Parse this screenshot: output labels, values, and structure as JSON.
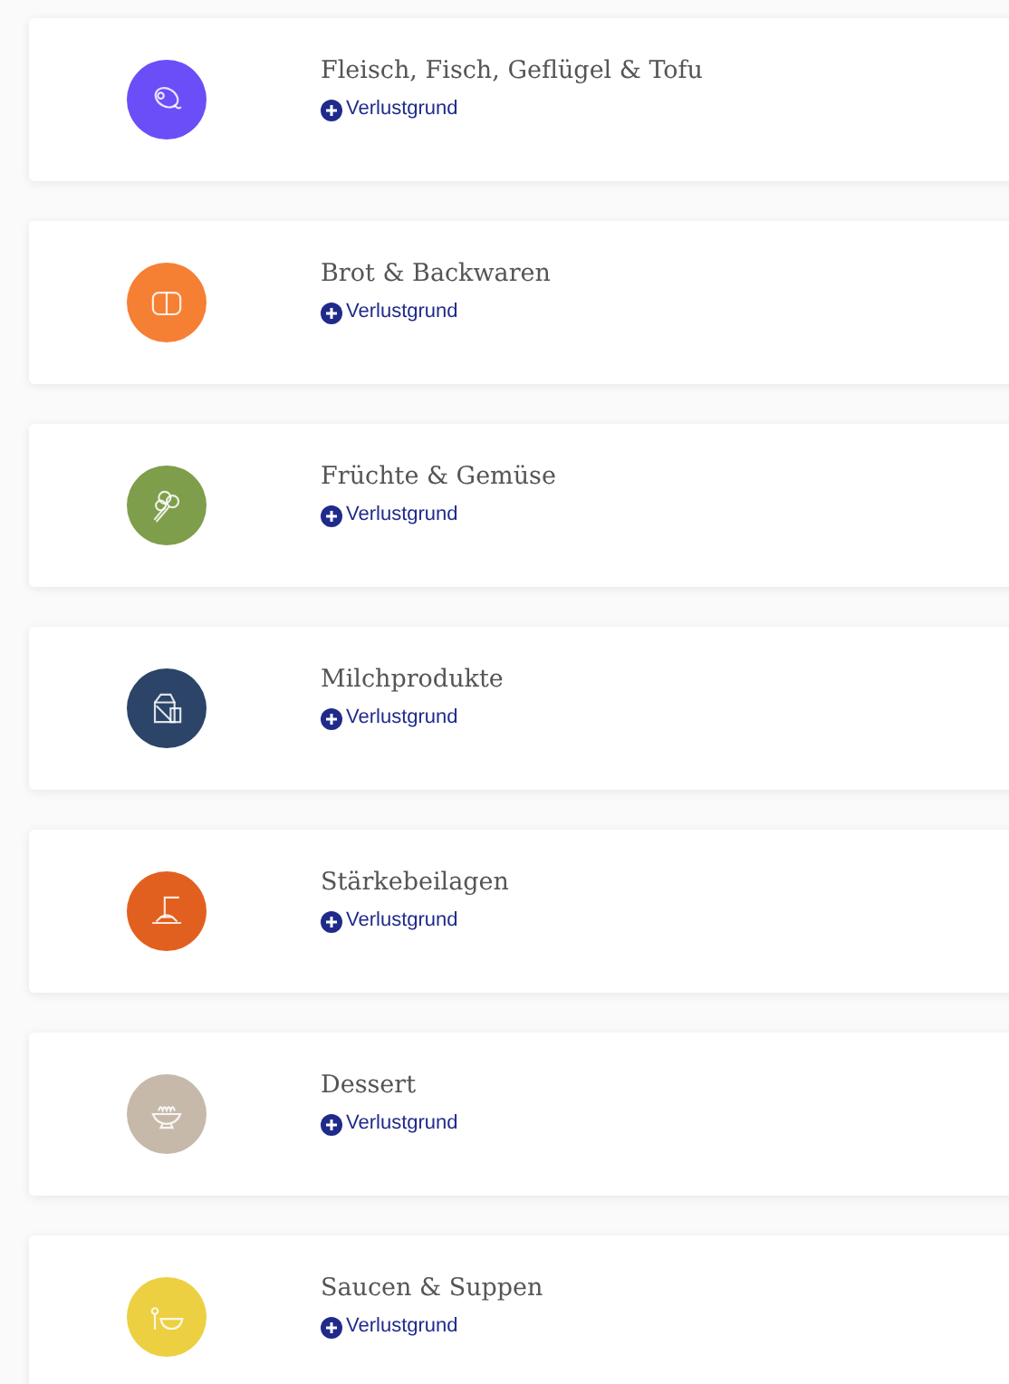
{
  "categories": [
    {
      "title": "Fleisch, Fisch, Geflügel & Tofu",
      "color": "#6b4ef7",
      "kind": "meat",
      "action": "Verlustgrund"
    },
    {
      "title": "Brot & Backwaren",
      "color": "#f58034",
      "kind": "bread",
      "action": "Verlustgrund"
    },
    {
      "title": "Früchte & Gemüse",
      "color": "#7f9e4b",
      "kind": "veg",
      "action": "Verlustgrund"
    },
    {
      "title": "Milchprodukte",
      "color": "#2b4468",
      "kind": "dairy",
      "action": "Verlustgrund"
    },
    {
      "title": "Stärkebeilagen",
      "color": "#e2601f",
      "kind": "pasta",
      "action": "Verlustgrund"
    },
    {
      "title": "Dessert",
      "color": "#c7b9aa",
      "kind": "dessert",
      "action": "Verlustgrund"
    },
    {
      "title": "Saucen & Suppen",
      "color": "#ecd041",
      "kind": "soup",
      "action": "Verlustgrund"
    }
  ]
}
